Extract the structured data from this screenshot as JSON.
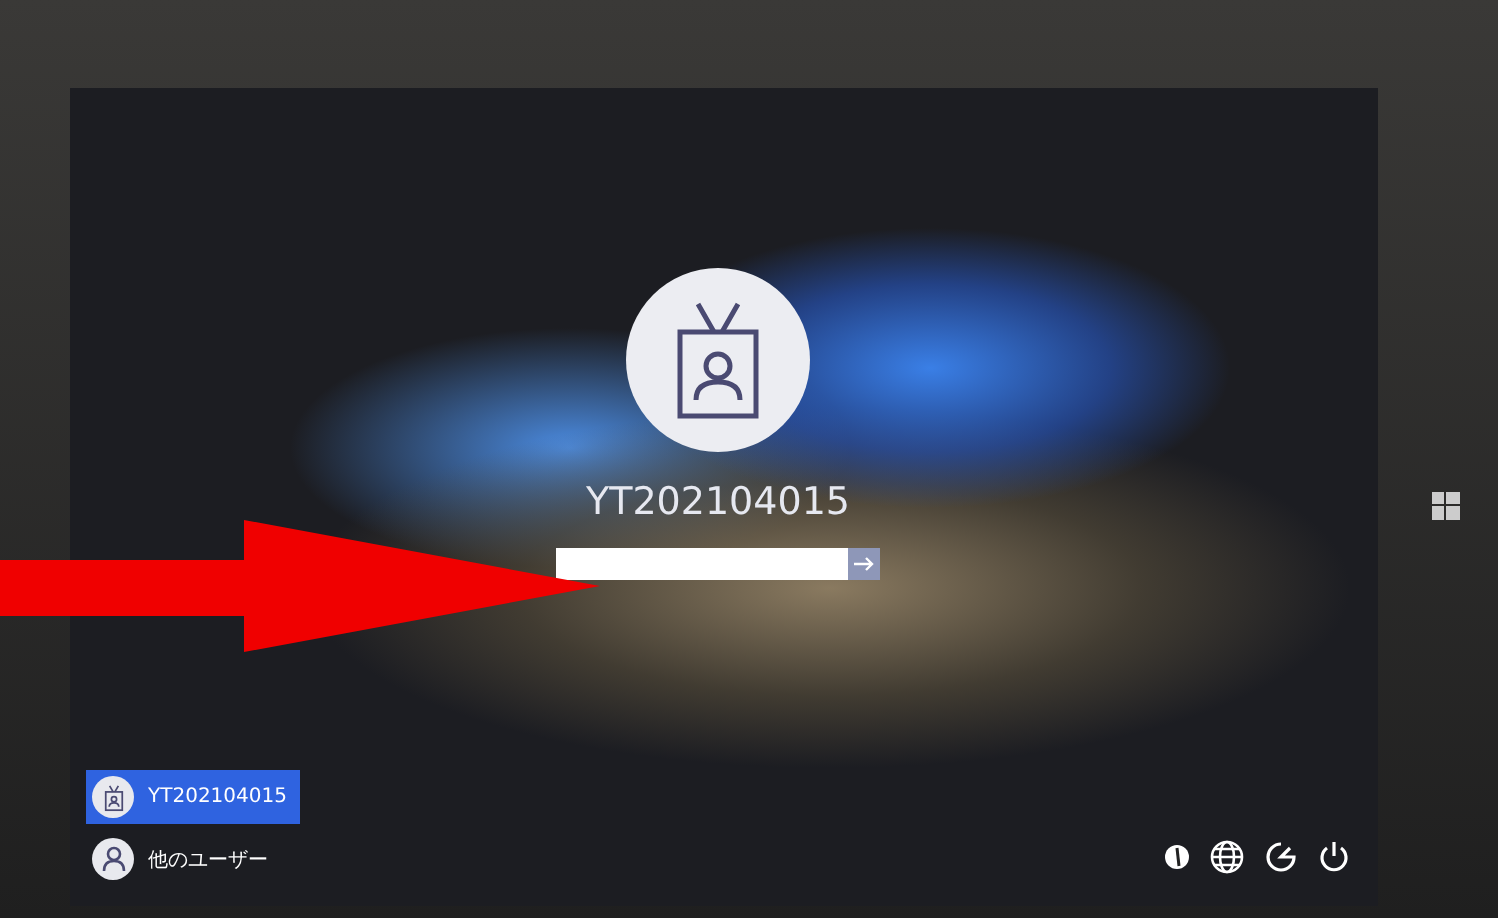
{
  "account": {
    "name": "YT202104015"
  },
  "users": [
    {
      "name": "YT202104015",
      "kind": "badge",
      "selected": true
    },
    {
      "name": "他のユーザー",
      "kind": "person",
      "selected": false
    }
  ]
}
